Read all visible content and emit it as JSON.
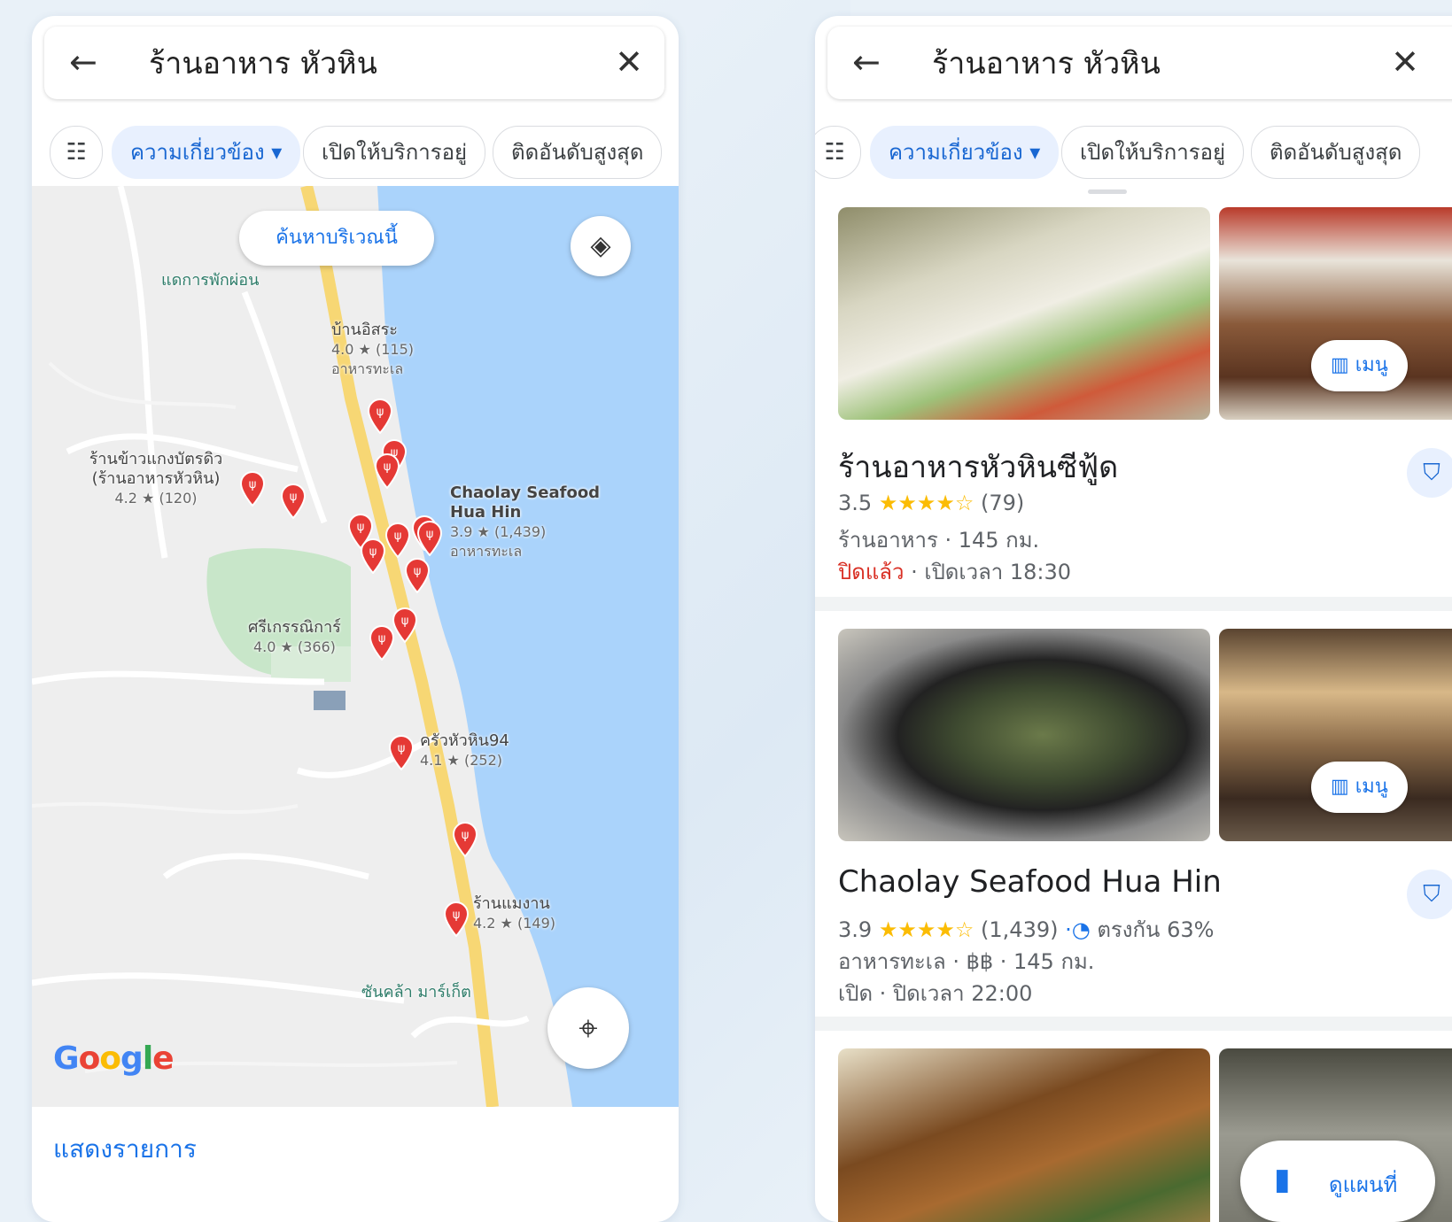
{
  "search": {
    "back_icon": "arrow-left-icon",
    "query": "ร้านอาหาร หัวหิน",
    "clear_icon": "close-icon"
  },
  "filters": {
    "filter_icon": "tune-icon",
    "chips": [
      "ความเกี่ยวข้อง ▾",
      "เปิดให้บริการอยู่",
      "ติดอันดับสูงสุด"
    ]
  },
  "map": {
    "search_area_button": "ค้นหาบริเวณนี้",
    "layers_icon": "layers-icon",
    "my_location_icon": "my-location-icon",
    "logo": "Google",
    "colors": {
      "water": "#aad3fb",
      "land": "#eeeeee",
      "road": "#f7d774",
      "park": "#c8e6c9",
      "pin": "#e53935"
    },
    "pois": [
      {
        "name": "แดการพักผ่อน"
      },
      {
        "name": "ซันคล้า มาร์เก็ต"
      }
    ],
    "places": [
      {
        "name": "บ้านอิสระ",
        "rating": "4.0 ★ (115)",
        "category": "อาหารทะเล"
      },
      {
        "name": "ร้านข้าวแกงบัตรดิว (ร้านอาหารหัวหิน)",
        "rating": "4.2 ★ (120)",
        "category": ""
      },
      {
        "name": "Chaolay Seafood Hua Hin",
        "rating": "3.9 ★ (1,439)",
        "category": "อาหารทะเล"
      },
      {
        "name": "ศรีเกรรณิการ์",
        "rating": "4.0 ★ (366)",
        "category": ""
      },
      {
        "name": "ครัวหัวหิน94",
        "rating": "4.1 ★ (252)",
        "category": ""
      },
      {
        "name": "ร้านแมงาน",
        "rating": "4.2 ★ (149)",
        "category": ""
      }
    ]
  },
  "list_toggle": "แสดงรายการ",
  "results": [
    {
      "name": "ร้านอาหารหัวหินซีฟู้ด",
      "rating": "3.5",
      "stars": "★★★★☆",
      "reviews": "(79)",
      "details": "ร้านอาหาร · 145 กม.",
      "status_closed": "ปิดแล้ว",
      "status_rest": " · เปิดเวลา 18:30",
      "menu_label": "เมนู",
      "save_icon": "bookmark-icon"
    },
    {
      "name": "Chaolay Seafood Hua Hin",
      "rating": "3.9",
      "stars": "★★★★☆",
      "reviews": "(1,439)",
      "match": "ตรงกัน 63%",
      "details": "อาหารทะเล · ฿฿ · 145 กม.",
      "status": "เปิด · ปิดเวลา 22:00",
      "menu_label": "เมนู",
      "save_icon": "bookmark-icon"
    }
  ],
  "view_map_button": "ดูแผนที่"
}
